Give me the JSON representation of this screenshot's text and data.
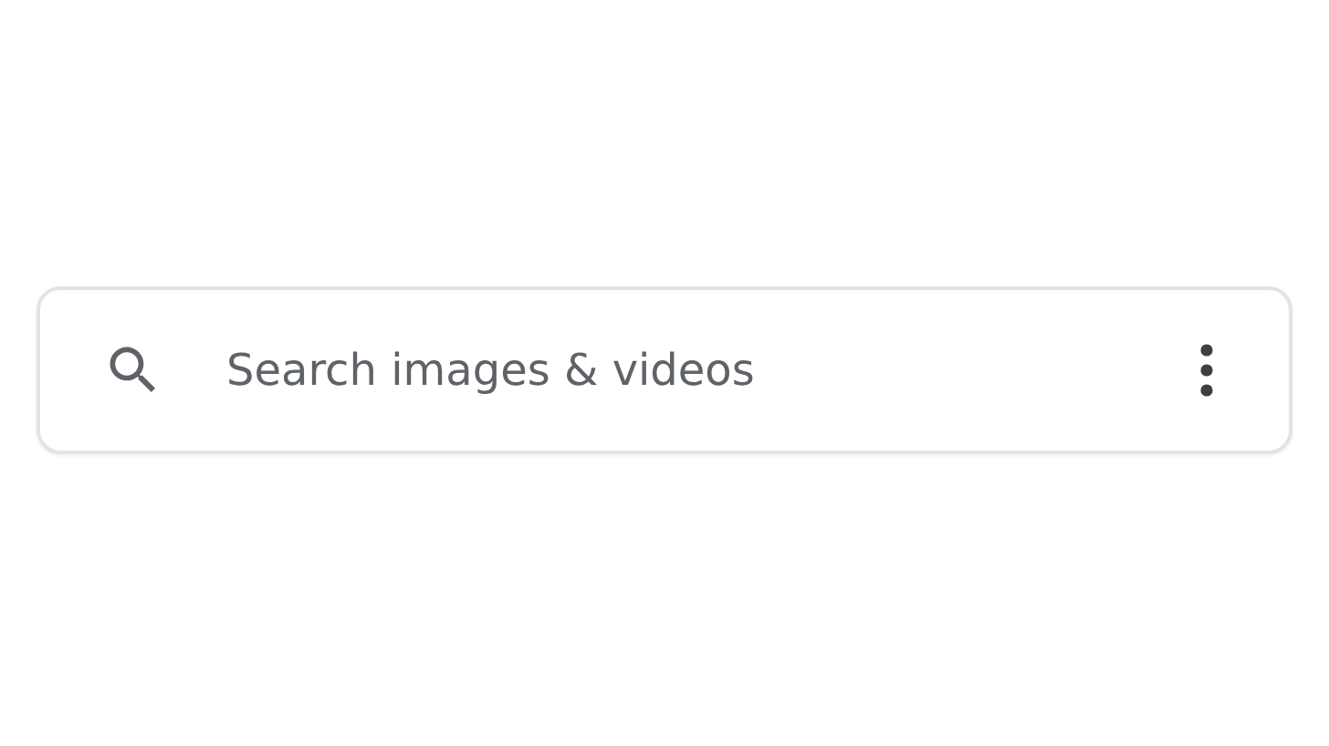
{
  "search": {
    "placeholder": "Search images & videos"
  }
}
